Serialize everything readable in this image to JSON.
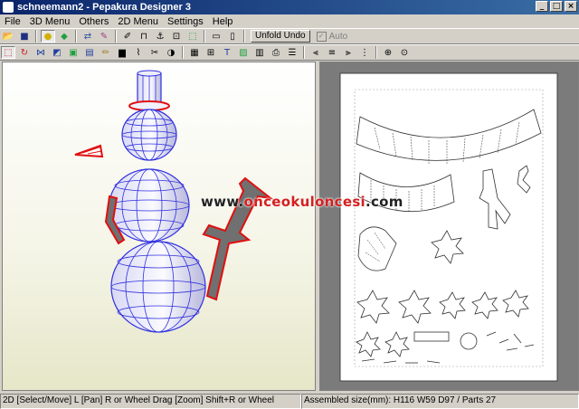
{
  "window": {
    "title": "schneemann2 - Pepakura Designer 3"
  },
  "menu": [
    "File",
    "3D Menu",
    "Others",
    "2D Menu",
    "Settings",
    "Help"
  ],
  "toolbar": {
    "unfold_undo": "Unfold Undo",
    "auto": "Auto"
  },
  "watermark": {
    "prefix": "www.",
    "brand": "onceokuloncesi",
    "suffix": ".com"
  },
  "status": {
    "left": "2D [Select/Move] L [Pan] R or Wheel Drag [Zoom] Shift+R or Wheel",
    "right": "Assembled size(mm): H116 W59 D97 / Parts 27"
  },
  "colors": {
    "title_bar": "#0a246a",
    "mesh": "#3030e0",
    "selected_edge": "#e01010",
    "part_fill": "#707070"
  }
}
